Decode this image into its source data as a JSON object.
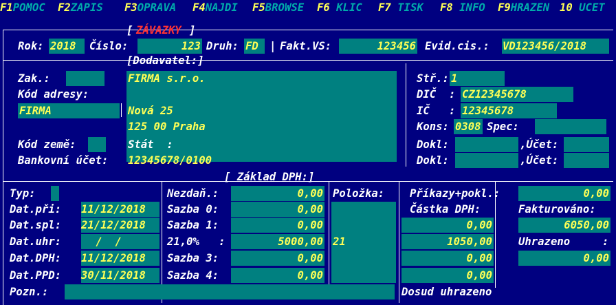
{
  "colors": {
    "background": "#000080",
    "field_background": "#008080",
    "field_text": "#ffff55",
    "label_text": "#ffffff",
    "fkey_label": "#00aaaa",
    "title_red": "#ff3333"
  },
  "fkeys": [
    {
      "num": "F1",
      "label": "POMOC"
    },
    {
      "num": "F2",
      "label": "ZAPIS"
    },
    {
      "num": "F3",
      "label": "OPRAVA"
    },
    {
      "num": "F4",
      "label": "NAJDI"
    },
    {
      "num": "F5",
      "label": "BROWSE"
    },
    {
      "num": "F6",
      "label": " KLIC"
    },
    {
      "num": "F7",
      "label": " TISK"
    },
    {
      "num": "F8",
      "label": " INFO"
    },
    {
      "num": "F9",
      "label": "HRAZEN"
    },
    {
      "num": "10",
      "label": " UCET"
    }
  ],
  "header": {
    "title": "ZÁVAZKY",
    "bracket_open": "[",
    "bracket_close": "]"
  },
  "row1": {
    "rok_label": "Rok:",
    "rok": "2018",
    "cislo_label": "Číslo:",
    "cislo": "123",
    "druh_label": "Druh:",
    "druh": "FD",
    "sep": "|",
    "fakt_label": "Fakt.VS:",
    "fakt": "123456",
    "evid_label": "Evid.cis.:",
    "evid": "VD123456/2018"
  },
  "dodavatel": {
    "section": "[Dodavatel:]",
    "zak_label": "Zak.:",
    "zak": "",
    "kod_adresy_label": "Kód adresy:",
    "name": "FIRMA s.r.o.",
    "short": "FIRMA",
    "street": "Nová 25",
    "city": "125 00 Praha",
    "kod_zeme_label": "Kód země:",
    "kod_zeme": "",
    "stat_label": "Stát  :",
    "stat": "",
    "bank_label": "Bankovní účet:",
    "bank": "12345678/0100",
    "str_label": "Stř.:",
    "str": "1",
    "dic_label": "DIČ  :",
    "dic": "CZ12345678",
    "ic_label": "IČ   :",
    "ic": "12345678",
    "kons_label": "Kons:",
    "kons": "0308",
    "spec_label": "Spec:",
    "spec": "",
    "dokl1_label": "Dokl:",
    "dokl1": "",
    "ucet1_label": ",Účet:",
    "ucet1": "",
    "dokl2_label": "Dokl:",
    "dokl2": "",
    "ucet2_label": ",Účet:",
    "ucet2": ""
  },
  "dph": {
    "section": "[ Základ DPH:]",
    "typ_label": "Typ:",
    "typ": "",
    "dat_pri_label": "Dat.při:",
    "dat_pri": "11/12/2018",
    "dat_spl_label": "Dat.spl:",
    "dat_spl": "21/12/2018",
    "dat_uhr_label": "Dat.uhr:",
    "dat_uhr": " /  /",
    "dat_dph_label": "Dat.DPH:",
    "dat_dph": "11/12/2018",
    "dat_ppd_label": "Dat.PPD:",
    "dat_ppd": "30/11/2018",
    "pozn_label": "Pozn.:",
    "pozn": "",
    "nezdan_label": "Nezdaň.:",
    "nezdan": "0,00",
    "sazba0_label": "Sazba 0:",
    "sazba0": "0,00",
    "sazba1_label": "Sazba 1:",
    "sazba1": "0,00",
    "sazba21_label": "21,0%   :",
    "sazba21": "5000,00",
    "sazba3_label": "Sazba 3:",
    "sazba3": "0,00",
    "sazba4_label": "Sazba 4:",
    "sazba4": "0,00",
    "polozka_label": "Položka:",
    "polozka21": "21",
    "prikazy_label": "Příkazy+pokl.:",
    "prikazy": "0,00",
    "castka_label": "Částka DPH:",
    "castka_rows": [
      "0,00",
      "1050,00",
      "0,00",
      "0,00"
    ],
    "fakturovano_label": "Fakturováno:",
    "fakturovano": "6050,00",
    "uhrazeno_label": "Uhrazeno",
    "uhrazeno_colon": ":",
    "uhrazeno": "0,00",
    "dosud_label": "Dosud uhrazeno"
  }
}
